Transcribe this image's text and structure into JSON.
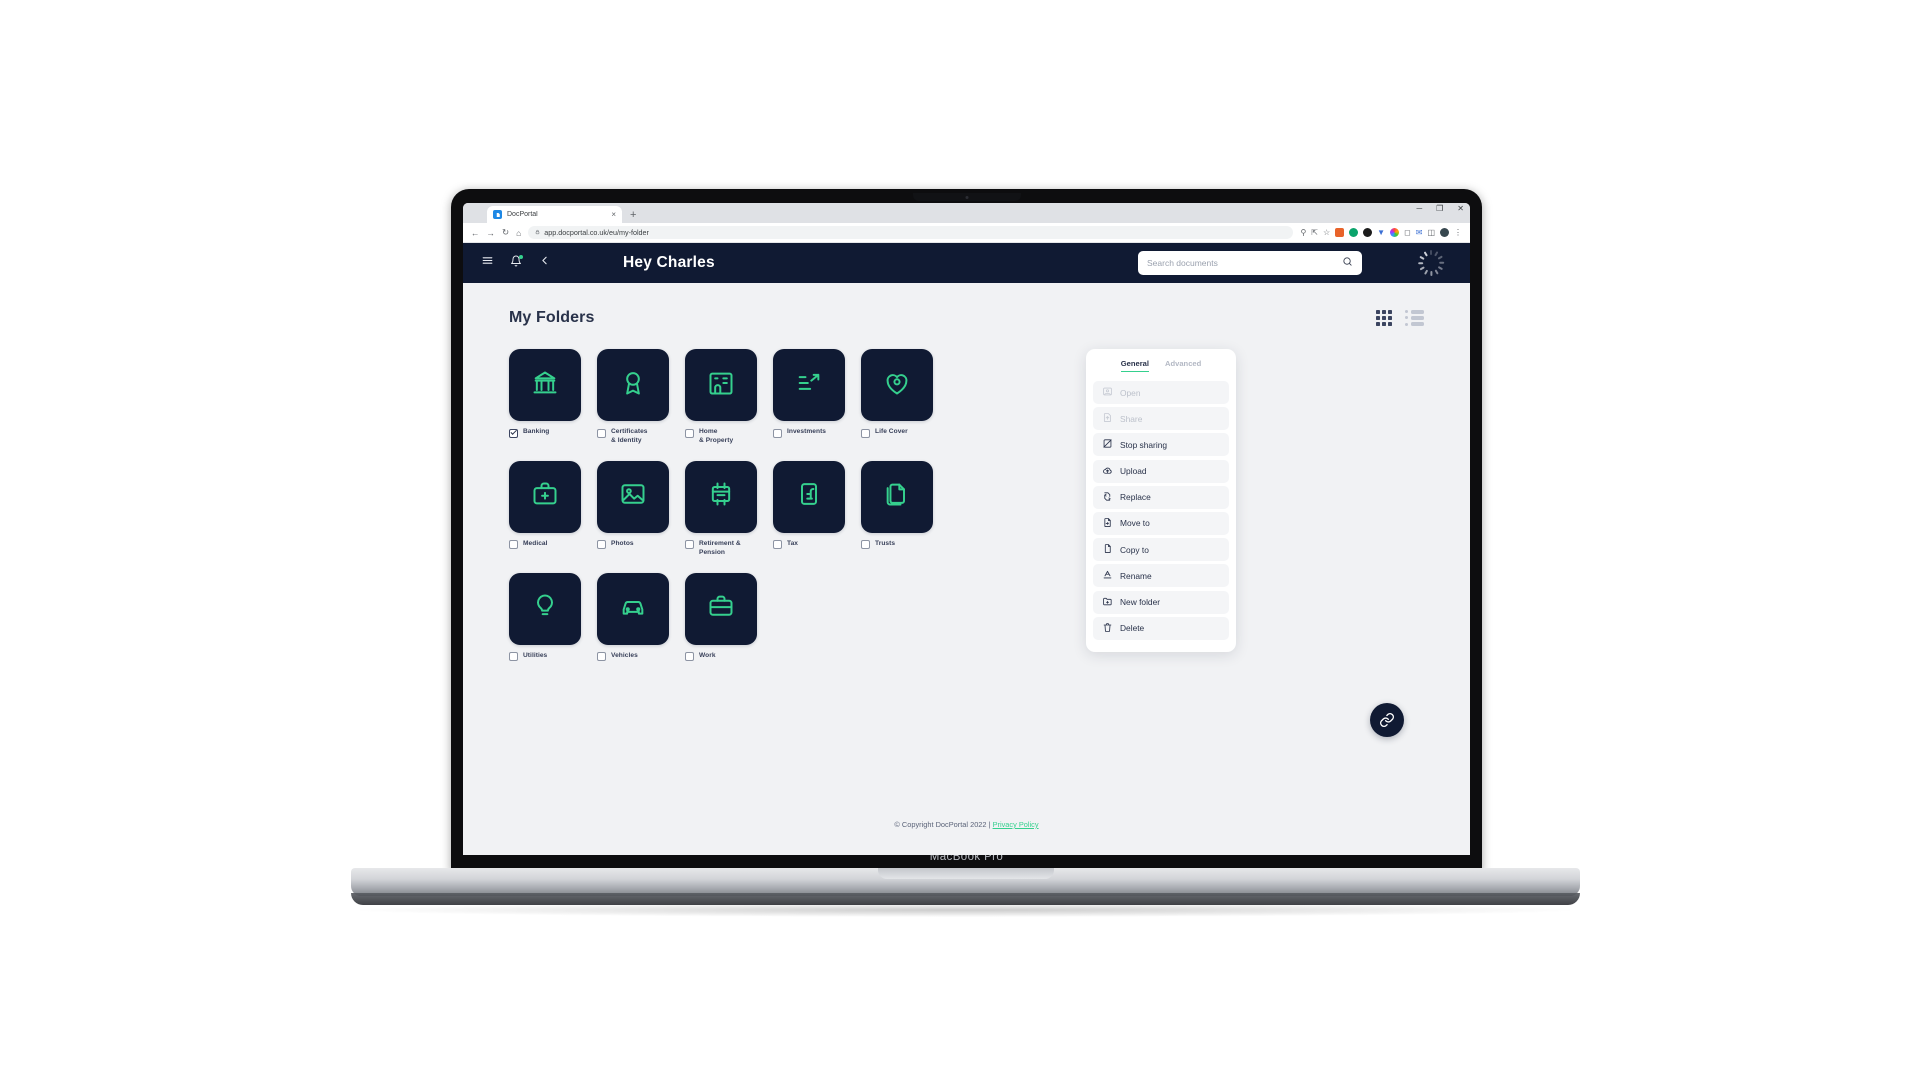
{
  "device": {
    "label": "MacBook Pro"
  },
  "browser": {
    "tab": {
      "title": "DocPortal",
      "favicon": "docportal-favicon",
      "close": "×"
    },
    "new_tab": "+",
    "nav": {
      "back": "←",
      "forward": "→",
      "reload": "↻",
      "home": "⌂"
    },
    "url": "app.docportal.co.uk/eu/my-folder",
    "lock_icon": "lock-icon",
    "window_controls": {
      "minimize": "─",
      "maximize": "❐",
      "close": "✕"
    },
    "extensions": [
      "key-icon",
      "share-icon",
      "bookmark-star-icon",
      "ext-orange",
      "ext-green",
      "ext-dark",
      "ext-blue",
      "ext-colorwheel",
      "ext-square",
      "ext-mail",
      "ext-panel",
      "ext-globe"
    ],
    "menu_icon": "⋮"
  },
  "appbar": {
    "menu_icon": "hamburger-menu-icon",
    "bell_icon": "notification-bell-icon",
    "back_icon": "back-chevron-icon",
    "title": "Hey Charles",
    "search": {
      "placeholder": "Search documents",
      "value": "",
      "icon": "search-icon"
    },
    "spinner": "loading-spinner"
  },
  "page": {
    "title": "My Folders",
    "view_grid": "grid-view-icon",
    "view_list": "list-view-icon",
    "active_view": "grid"
  },
  "folders": [
    {
      "label": "Banking",
      "icon": "bank-icon",
      "checked": true
    },
    {
      "label": "Certificates\n& Identity",
      "icon": "award-icon",
      "checked": false
    },
    {
      "label": "Home\n& Property",
      "icon": "building-icon",
      "checked": false
    },
    {
      "label": "Investments",
      "icon": "growth-icon",
      "checked": false
    },
    {
      "label": "Life Cover",
      "icon": "heart-shield-icon",
      "checked": false
    },
    {
      "label": "Medical",
      "icon": "medical-kit-icon",
      "checked": false
    },
    {
      "label": "Photos",
      "icon": "photo-icon",
      "checked": false
    },
    {
      "label": "Retirement &\nPension",
      "icon": "pension-icon",
      "checked": false
    },
    {
      "label": "Tax",
      "icon": "pound-note-icon",
      "checked": false
    },
    {
      "label": "Trusts",
      "icon": "documents-icon",
      "checked": false
    },
    {
      "label": "Utilities",
      "icon": "lightbulb-icon",
      "checked": false
    },
    {
      "label": "Vehicles",
      "icon": "car-icon",
      "checked": false
    },
    {
      "label": "Work",
      "icon": "briefcase-icon",
      "checked": false
    }
  ],
  "menu": {
    "tabs": [
      {
        "label": "General",
        "active": true
      },
      {
        "label": "Advanced",
        "active": false
      }
    ],
    "items": [
      {
        "label": "Open",
        "icon": "open-icon",
        "disabled": true
      },
      {
        "label": "Share",
        "icon": "share-icon",
        "disabled": true
      },
      {
        "label": "Stop sharing",
        "icon": "stop-share-icon",
        "disabled": false
      },
      {
        "label": "Upload",
        "icon": "upload-cloud-icon",
        "disabled": false
      },
      {
        "label": "Replace",
        "icon": "replace-icon",
        "disabled": false
      },
      {
        "label": "Move to",
        "icon": "move-to-icon",
        "disabled": false
      },
      {
        "label": "Copy to",
        "icon": "copy-to-icon",
        "disabled": false
      },
      {
        "label": "Rename",
        "icon": "rename-icon",
        "disabled": false
      },
      {
        "label": "New folder",
        "icon": "new-folder-icon",
        "disabled": false
      },
      {
        "label": "Delete",
        "icon": "trash-icon",
        "disabled": false
      }
    ]
  },
  "fab": {
    "icon": "link-chain-icon"
  },
  "footer": {
    "copyright": "© Copyright DocPortal 2022 |",
    "link": "Privacy Policy"
  },
  "colors": {
    "navy": "#101a33",
    "green": "#35d08e",
    "page_bg": "#f1f2f4",
    "text": "#29324a"
  }
}
